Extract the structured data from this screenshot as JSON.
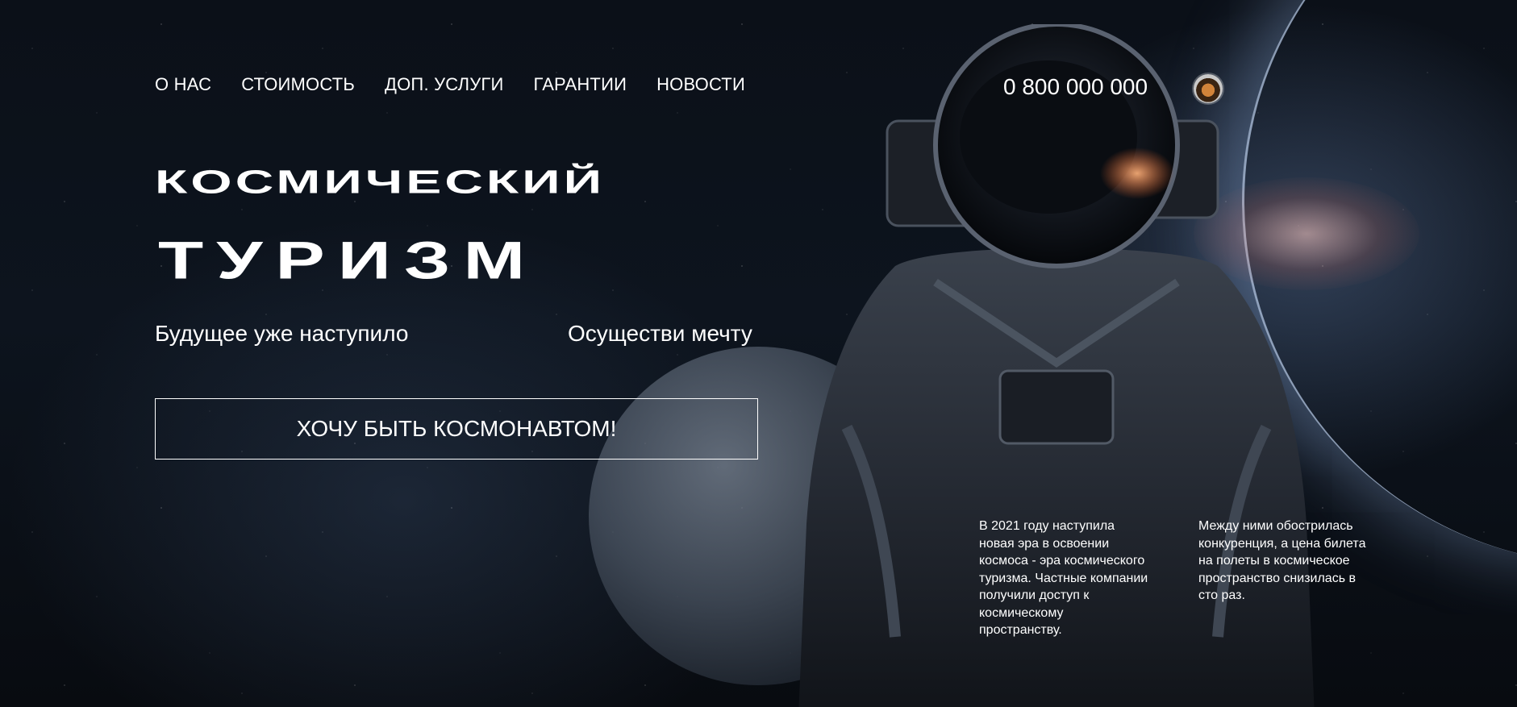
{
  "nav": {
    "items": [
      "О НАС",
      "СТОИМОСТЬ",
      "ДОП. УСЛУГИ",
      "ГАРАНТИИ",
      "НОВОСТИ"
    ]
  },
  "header": {
    "phone": "0 800 000 000",
    "avatar_icon": "astronaut-avatar-icon"
  },
  "hero": {
    "title_line1": "КОСМИЧЕСКИЙ",
    "title_line2": "ТУРИЗМ",
    "tagline_left": "Будущее уже наступило",
    "tagline_right": "Осуществи мечту",
    "cta_label": "ХОЧУ БЫТЬ КОСМОНАВТОМ!"
  },
  "info": {
    "block1": "В 2021 году наступила новая эра в освоении космоса - эра космического туризма. Частные компании получили доступ к космическому пространству.",
    "block2": "Между ними обострилась конкуренция, а цена билета на полеты в космическое пространство снизилась в сто раз."
  },
  "colors": {
    "background": "#070a10",
    "text": "#ffffff"
  }
}
